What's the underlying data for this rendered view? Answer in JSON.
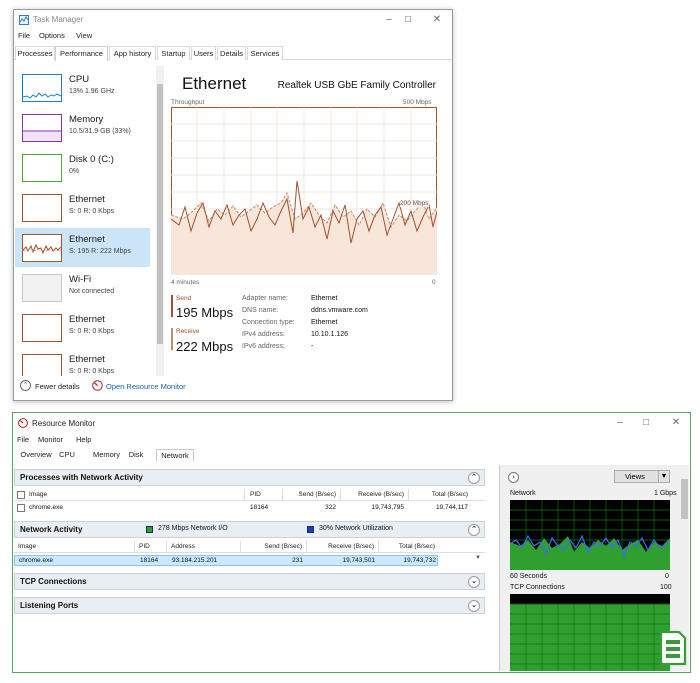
{
  "task_manager": {
    "title": "Task Manager",
    "menu": [
      "File",
      "Options",
      "View"
    ],
    "tabs": [
      "Processes",
      "Performance",
      "App history",
      "Startup",
      "Users",
      "Details",
      "Services"
    ],
    "active_tab": "Performance",
    "sidebar": [
      {
        "name": "CPU",
        "sub": "13% 1.96 GHz",
        "color": "#1c7fc4"
      },
      {
        "name": "Memory",
        "sub": "10.5/31.9 GB (33%)",
        "color": "#8b2fb0"
      },
      {
        "name": "Disk 0 (C:)",
        "sub": "0%",
        "color": "#4da82f"
      },
      {
        "name": "Ethernet",
        "sub": "S: 0 R: 0 Kbps",
        "color": "#a0522d"
      },
      {
        "name": "Ethernet",
        "sub": "S: 195 R: 222 Mbps",
        "color": "#a0522d"
      },
      {
        "name": "Wi-Fi",
        "sub": "Not connected",
        "color": "#a0a0a0"
      },
      {
        "name": "Ethernet",
        "sub": "S: 0 R: 0 Kbps",
        "color": "#a0522d"
      },
      {
        "name": "Ethernet",
        "sub": "S: 0 R: 0 Kbps",
        "color": "#a0522d"
      }
    ],
    "main": {
      "title": "Ethernet",
      "adapter": "Realtek USB GbE Family Controller",
      "throughput_label": "Throughput",
      "max_label": "500 Mbps",
      "mid_label": "200 Mbps",
      "time_label": "4 minutes",
      "zero_label": "0",
      "send_label": "Send",
      "send_value": "195 Mbps",
      "receive_label": "Receive",
      "receive_value": "222 Mbps",
      "details": [
        {
          "k": "Adapter name:",
          "v": "Ethernet"
        },
        {
          "k": "DNS name:",
          "v": "ddns.vmware.com"
        },
        {
          "k": "Connection type:",
          "v": "Ethernet"
        },
        {
          "k": "IPv4 address:",
          "v": "10.10.1.126"
        },
        {
          "k": "IPv6 address:",
          "v": "-"
        }
      ]
    },
    "footer": {
      "fewer_details": "Fewer details",
      "open_rm": "Open Resource Monitor"
    }
  },
  "resource_monitor": {
    "title": "Resource Monitor",
    "menu": [
      "File",
      "Monitor",
      "Help"
    ],
    "tabs": [
      "Overview",
      "CPU",
      "Memory",
      "Disk",
      "Network"
    ],
    "active_tab": "Network",
    "processes": {
      "title": "Processes with Network Activity",
      "headers": [
        "Image",
        "PID",
        "Send (B/sec)",
        "Receive (B/sec)",
        "Total (B/sec)"
      ],
      "rows": [
        [
          "chrome.exe",
          "18164",
          "322",
          "19,743,795",
          "19,744,117"
        ]
      ]
    },
    "network_activity": {
      "title": "Network Activity",
      "io_label": "278 Mbps Network I/O",
      "util_label": "30% Network Utilization",
      "headers": [
        "Image",
        "PID",
        "Address",
        "Send (B/sec)",
        "Receive (B/sec)",
        "Total (B/sec)"
      ],
      "rows": [
        [
          "chrome.exe",
          "18164",
          "93.184.215.201",
          "231",
          "19,743,501",
          "19,743,732"
        ]
      ]
    },
    "tcp_title": "TCP Connections",
    "listening_title": "Listening Ports",
    "right": {
      "views": "Views",
      "network_label": "Network",
      "network_max": "1 Gbps",
      "network_time": "60 Seconds",
      "network_zero": "0",
      "tcp_label": "TCP Connections",
      "tcp_max": "100"
    }
  }
}
